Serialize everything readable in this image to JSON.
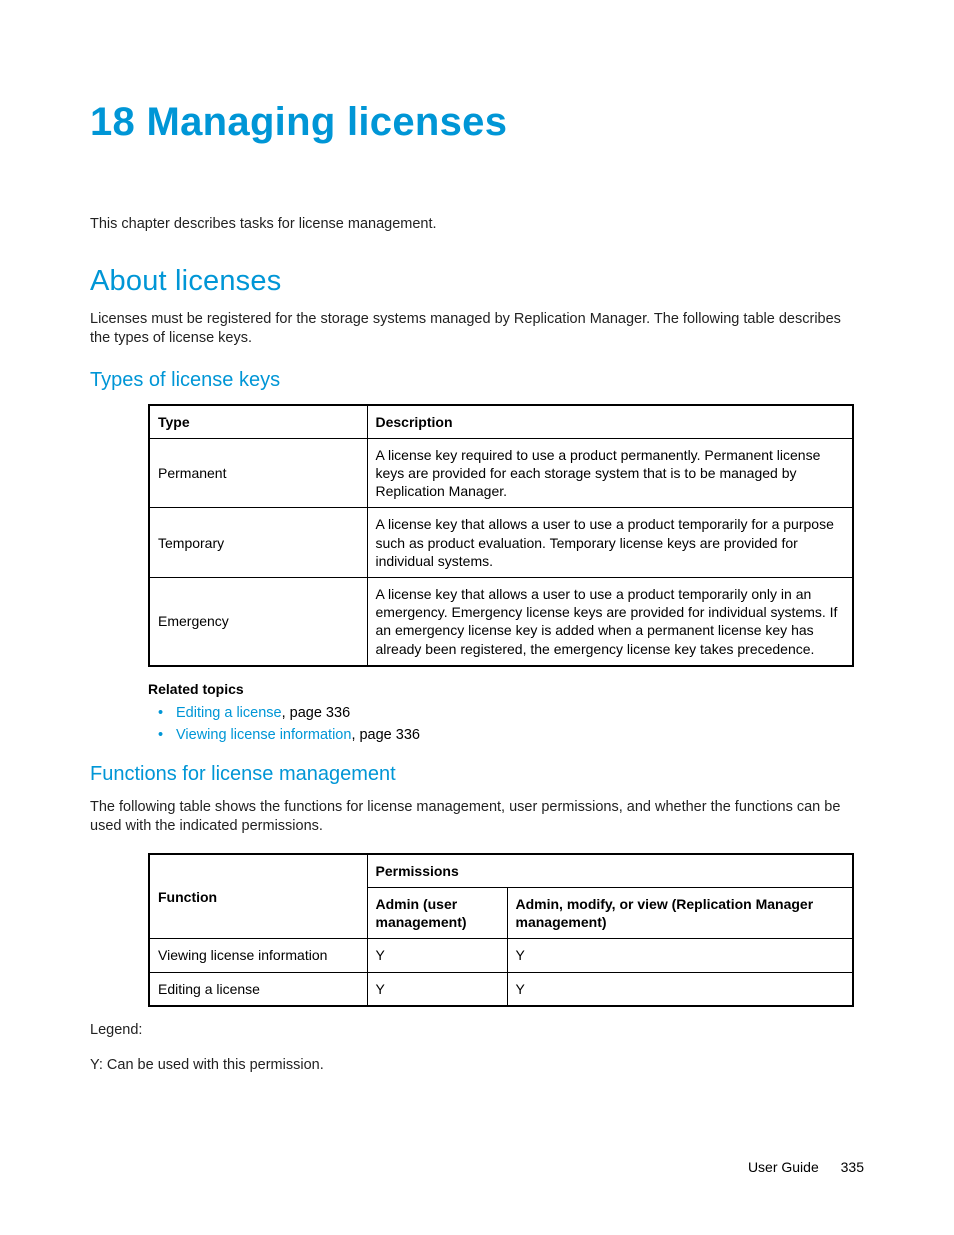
{
  "chapter_title": "18 Managing licenses",
  "intro": "This chapter describes tasks for license management.",
  "section_about": {
    "heading": "About licenses",
    "body": "Licenses must be registered for the storage systems managed by Replication Manager. The following table describes the types of license keys."
  },
  "subsection_types": {
    "heading": "Types of license keys",
    "table": {
      "headers": {
        "type": "Type",
        "desc": "Description"
      },
      "rows": [
        {
          "type": "Permanent",
          "desc": "A license key required to use a product permanently. Permanent license keys are provided for each storage system that is to be managed by Replication Manager."
        },
        {
          "type": "Temporary",
          "desc": "A license key that allows a user to use a product temporarily for a purpose such as product evaluation. Temporary license keys are provided for individual systems."
        },
        {
          "type": "Emergency",
          "desc": "A license key that allows a user to use a product temporarily only in an emergency. Emergency license keys are provided for individual systems. If an emergency license key is added when a permanent license key has already been registered, the emergency license key takes precedence."
        }
      ]
    }
  },
  "related": {
    "heading": "Related topics",
    "items": [
      {
        "link": "Editing a license",
        "suffix": ", page 336"
      },
      {
        "link": "Viewing license information",
        "suffix": ", page 336"
      }
    ]
  },
  "subsection_functions": {
    "heading": "Functions for license management",
    "body": "The following table shows the functions for license management, user permissions, and whether the functions can be used with the indicated permissions.",
    "table": {
      "headers": {
        "function": "Function",
        "permissions": "Permissions",
        "admin_user": "Admin (user management)",
        "admin_rep": "Admin, modify, or view (Replication Manager management)"
      },
      "rows": [
        {
          "function": "Viewing license information",
          "admin_user": "Y",
          "admin_rep": "Y"
        },
        {
          "function": "Editing a license",
          "admin_user": "Y",
          "admin_rep": "Y"
        }
      ]
    },
    "legend_label": "Legend:",
    "legend_body": "Y: Can be used with this permission."
  },
  "footer": {
    "doc": "User Guide",
    "page": "335"
  }
}
